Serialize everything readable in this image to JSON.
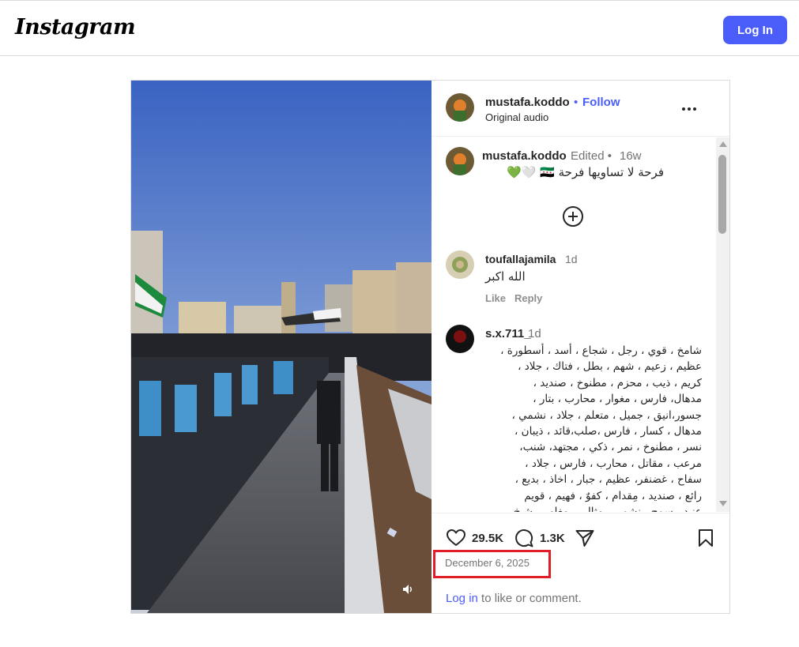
{
  "app": {
    "logo": "Instagram",
    "login_button": "Log In"
  },
  "colors": {
    "accent": "#4a5df9",
    "highlight_box": "#e01e2a",
    "secondary_text": "#737373",
    "border": "#dbdbdb"
  },
  "post": {
    "author": "mustafa.koddo",
    "header_dot": "•",
    "follow": "Follow",
    "audio": "Original audio",
    "caption": {
      "author": "mustafa.koddo",
      "edited": "Edited •",
      "age": "16w",
      "text": "فرحة لا تساويها فرحة 🇸🇾 🤍💚"
    },
    "comments": [
      {
        "user": "toufallajamila",
        "age": "1d",
        "text": "الله اكبر",
        "like": "Like",
        "reply": "Reply"
      },
      {
        "user": "s.x.711_",
        "age": "1d",
        "lines": [
          "شامخ ، قوي ، رجل ، شجاع ، أسد ، أسطورة ،",
          "عظيم ، زعيم ، شهم ، بطل ، فتاك ، جلاد ،",
          "كريم ، ذيب ، محزم ، مطنوخ ، صنديد ،",
          "مدهال، فارس ، مغوار ، محارب ، بتار ،",
          "جسور،انيق ، جميل ، متعلم ، جلاد ، نشمي ،",
          "مدهال ، كسار ، فارس ،صلب،قائد ، ذيبان ،",
          "نسر ، مطنوخ ، نمر ، ذكي ، مجتهد، شنب،",
          "مرعب ، مقاتل ، محارب ، فارس ، جلاد ،",
          "سفاح ، غضنفر، عظيم ، جبار ، اخاذ ، بديع ،",
          "رائع ، صنديد ، مِقدام ، كفوٌ ، فهيم ، قويم",
          "عنيد ، سمح ، نشمي ، مثالي ، مغامر ، شيخ"
        ]
      }
    ],
    "likes": "29.5K",
    "comments_count": "1.3K",
    "date": "December 6, 2025",
    "login_prompt": {
      "link": "Log in",
      "rest": " to like or comment."
    }
  },
  "icons": [
    "more-icon",
    "plus-circle-icon",
    "heart-icon",
    "comment-icon",
    "share-icon",
    "save-icon",
    "mute-icon"
  ]
}
